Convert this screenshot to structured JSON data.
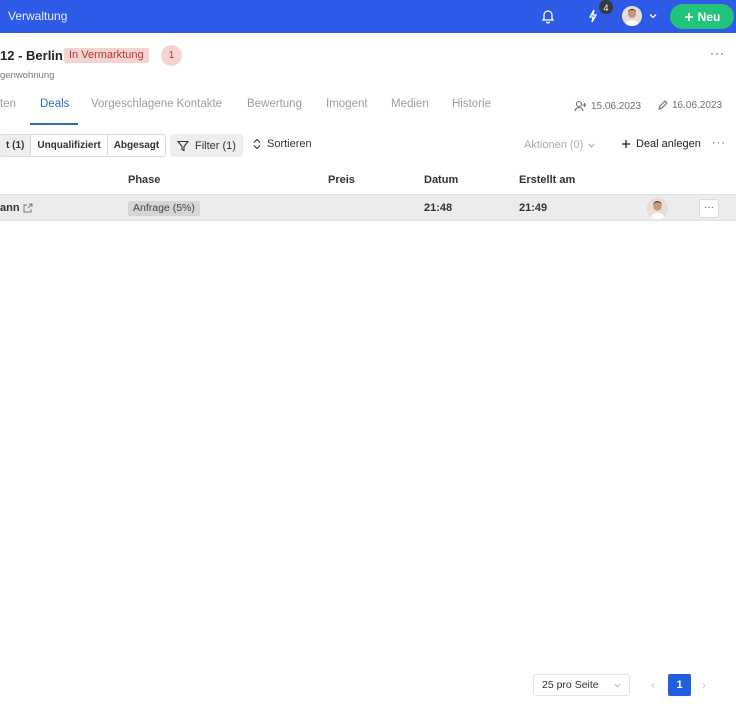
{
  "topbar": {
    "title": "Verwaltung",
    "notifications_badge": "4",
    "new_button_label": "Neu",
    "icons": [
      "bell-icon",
      "bolt-icon",
      "chevron-down-icon",
      "plus-icon"
    ]
  },
  "header": {
    "title": "12 - Berlin",
    "status": "In Vermarktung",
    "count": "1",
    "subtitle": "genwohnung",
    "more": "···"
  },
  "tabs": [
    {
      "label": "ten"
    },
    {
      "label": "Deals"
    },
    {
      "label": "Vorgeschlagene Kontakte"
    },
    {
      "label": "Bewertung"
    },
    {
      "label": "Imogent"
    },
    {
      "label": "Medien"
    },
    {
      "label": "Historie"
    }
  ],
  "meta": {
    "created": "15.06.2023",
    "edited": "16.06.2023"
  },
  "toolbar": {
    "segments": [
      "t (1)",
      "Unqualifiziert",
      "Abgesagt"
    ],
    "filter_label": "Filter (1)",
    "sort_label": "Sortieren",
    "actions_label": "Aktionen (0)",
    "add_deal_label": "Deal anlegen",
    "more": "···"
  },
  "table": {
    "headers": [
      "Phase",
      "Preis",
      "Datum",
      "Erstellt am"
    ],
    "rows": [
      {
        "name": "ann",
        "phase": "Anfrage (5%)",
        "price": "",
        "date": "21:48",
        "created": "21:49",
        "menu": "···"
      }
    ]
  },
  "pagination": {
    "per_page": "25 pro Seite",
    "current_page": "1",
    "prev": "‹",
    "next": "›"
  },
  "colors": {
    "topbar": "#2d5ae6",
    "new_button": "#22c37a",
    "status_bg": "#f6d3d3",
    "status_text": "#b23838",
    "active_tab": "#2a6fb8",
    "pager_active": "#1f5fe0"
  }
}
